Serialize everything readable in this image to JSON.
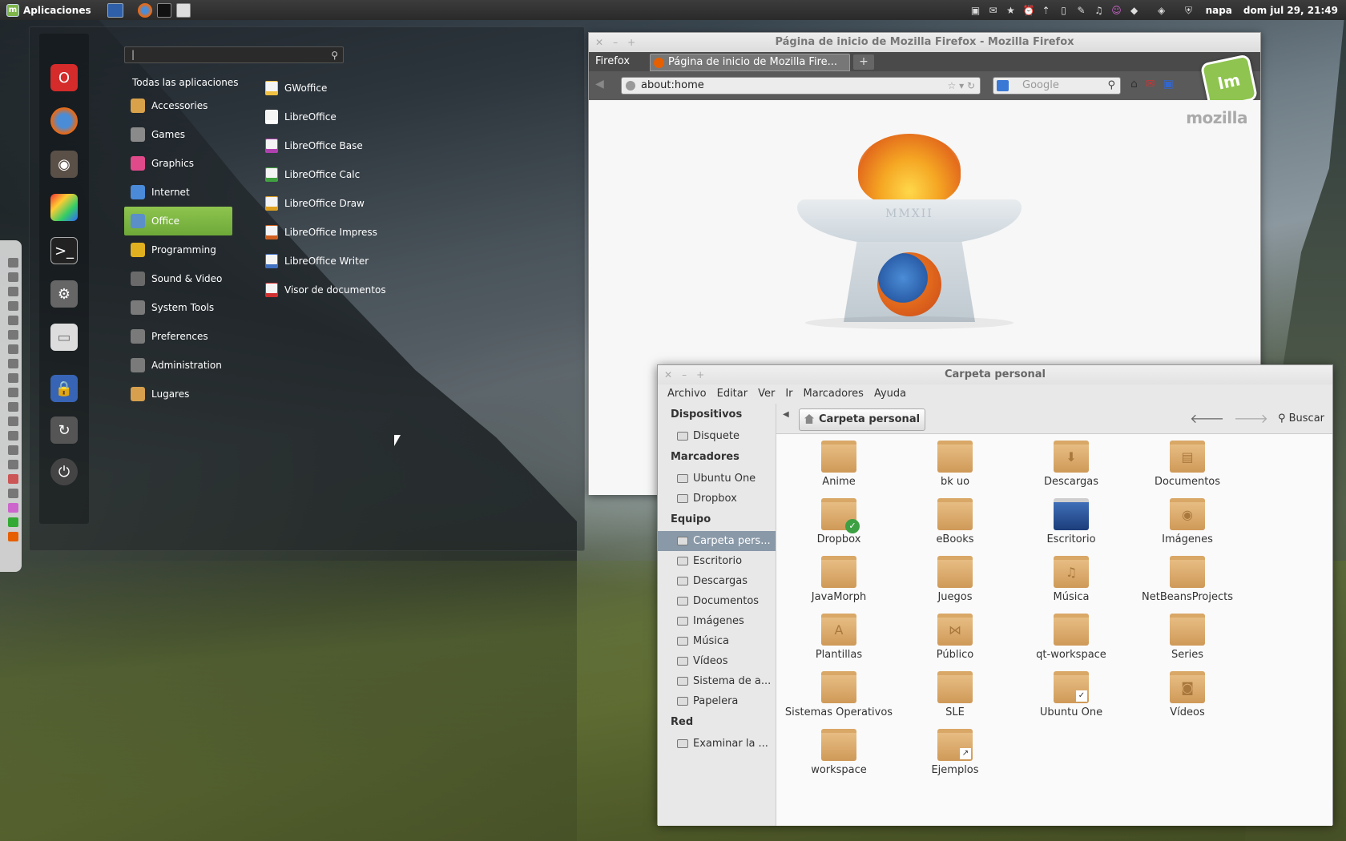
{
  "panel": {
    "menu_label": "Aplicaciones",
    "user": "napa",
    "clock": "dom jul 29, 21:49",
    "tray_icons": [
      "camera-icon",
      "mail-icon",
      "star-icon",
      "alarm-icon",
      "upload-icon",
      "usb-icon",
      "pen-icon",
      "music-icon",
      "pidgin-icon",
      "dropbox-icon",
      "network-icon",
      "shield-icon"
    ]
  },
  "menu": {
    "search_value": "|",
    "all_apps": "Todas las aplicaciones",
    "categories": [
      {
        "label": "Accessories",
        "color": "#d9a14a"
      },
      {
        "label": "Games",
        "color": "#8a8a8a"
      },
      {
        "label": "Graphics",
        "color": "#e04a8a"
      },
      {
        "label": "Internet",
        "color": "#4a8ad9"
      },
      {
        "label": "Office",
        "color": "#5b8fc9"
      },
      {
        "label": "Programming",
        "color": "#e0b020"
      },
      {
        "label": "Sound & Video",
        "color": "#6a6a6a"
      },
      {
        "label": "System Tools",
        "color": "#7a7a7a"
      },
      {
        "label": "Preferences",
        "color": "#7a7a7a"
      },
      {
        "label": "Administration",
        "color": "#7a7a7a"
      },
      {
        "label": "Lugares",
        "color": "#d6a04e"
      }
    ],
    "apps": [
      {
        "label": "GWoffice",
        "color": "#f0c040"
      },
      {
        "label": "LibreOffice",
        "color": "#ffffff"
      },
      {
        "label": "LibreOffice Base",
        "color": "#b040b0"
      },
      {
        "label": "LibreOffice Calc",
        "color": "#40a040"
      },
      {
        "label": "LibreOffice Draw",
        "color": "#e0a020"
      },
      {
        "label": "LibreOffice Impress",
        "color": "#d06020"
      },
      {
        "label": "LibreOffice Writer",
        "color": "#4070c0"
      },
      {
        "label": "Visor de documentos",
        "color": "#d03030"
      }
    ]
  },
  "firefox": {
    "title": "Página de inicio de Mozilla Firefox - Mozilla Firefox",
    "menu_button": "Firefox",
    "tab_label": "Página de inicio de Mozilla Fire...",
    "url": "about:home",
    "search_placeholder": "Google",
    "brand": "mozilla",
    "torch_text": "MMXII"
  },
  "nemo": {
    "title": "Carpeta personal",
    "menus": [
      "Archivo",
      "Editar",
      "Ver",
      "Ir",
      "Marcadores",
      "Ayuda"
    ],
    "breadcrumb": "Carpeta personal",
    "search_label": "Buscar",
    "sidebar": {
      "devices_heading": "Dispositivos",
      "devices": [
        "Disquete"
      ],
      "bookmarks_heading": "Marcadores",
      "bookmarks": [
        "Ubuntu One",
        "Dropbox"
      ],
      "computer_heading": "Equipo",
      "computer": [
        "Carpeta pers...",
        "Escritorio",
        "Descargas",
        "Documentos",
        "Imágenes",
        "Música",
        "Vídeos",
        "Sistema de a...",
        "Papelera"
      ],
      "network_heading": "Red",
      "network": [
        "Examinar la ..."
      ]
    },
    "files": [
      "Anime",
      "bk uo",
      "Descargas",
      "Documentos",
      "Dropbox",
      "eBooks",
      "Escritorio",
      "Imágenes",
      "JavaMorph",
      "Juegos",
      "Música",
      "NetBeansProjects",
      "Plantillas",
      "Público",
      "qt-workspace",
      "Series",
      "Sistemas Operativos",
      "SLE",
      "Ubuntu One",
      "Vídeos",
      "workspace",
      "Ejemplos"
    ]
  }
}
